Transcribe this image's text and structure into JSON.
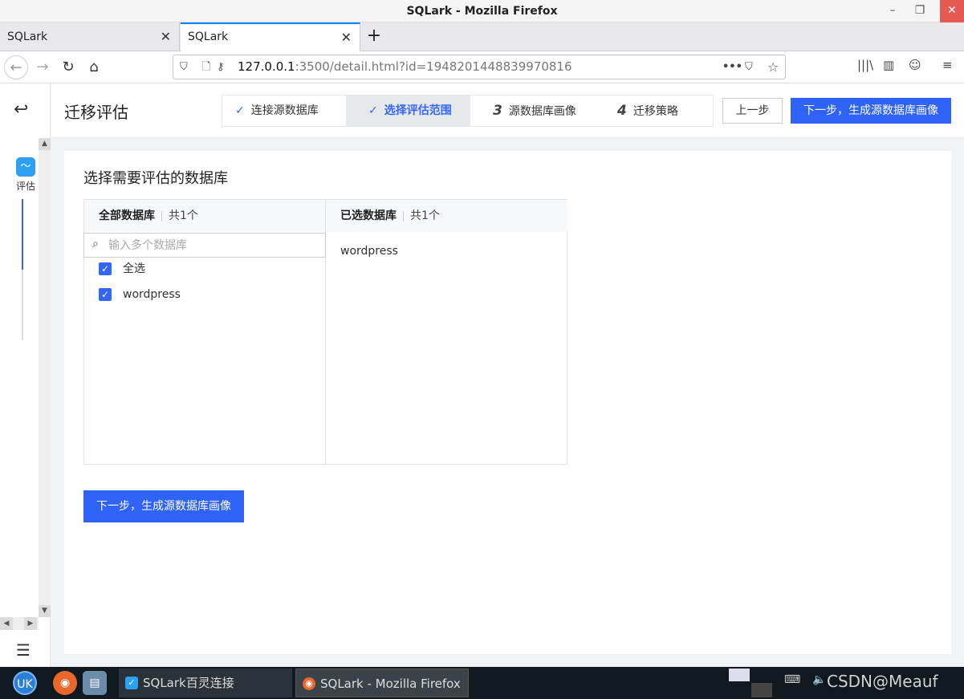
{
  "window": {
    "title": "SQLark - Mozilla Firefox"
  },
  "tabs": [
    {
      "label": "SQLark"
    },
    {
      "label": "SQLark"
    }
  ],
  "address": {
    "host": "127.0.0.1",
    "rest": ":3500/detail.html?id=1948201448839970816"
  },
  "sidebar": {
    "item_label": "评估"
  },
  "header": {
    "title": "迁移评估",
    "steps": [
      {
        "label": "连接源数据库",
        "state": "done"
      },
      {
        "label": "选择评估范围",
        "state": "active"
      },
      {
        "number": "3",
        "label": "源数据库画像",
        "state": "todo"
      },
      {
        "number": "4",
        "label": "迁移策略",
        "state": "todo"
      }
    ],
    "prev_label": "上一步",
    "next_label": "下一步，生成源数据库画像"
  },
  "main": {
    "section_title": "选择需要评估的数据库",
    "all_panel": {
      "title": "全部数据库",
      "count": "共1个",
      "search_placeholder": "输入多个数据库",
      "select_all": "全选",
      "items": [
        "wordpress"
      ]
    },
    "selected_panel": {
      "title": "已选数据库",
      "count": "共1个",
      "items": [
        "wordpress"
      ]
    },
    "next_label": "下一步，生成源数据库画像"
  },
  "taskbar": {
    "tasks": [
      "SQLark百灵连接",
      "SQLark - Mozilla Firefox"
    ],
    "watermark": "CSDN@Meauf"
  },
  "colors": {
    "accent": "#2f63f5",
    "step_active_bg": "#e6e8ec"
  }
}
